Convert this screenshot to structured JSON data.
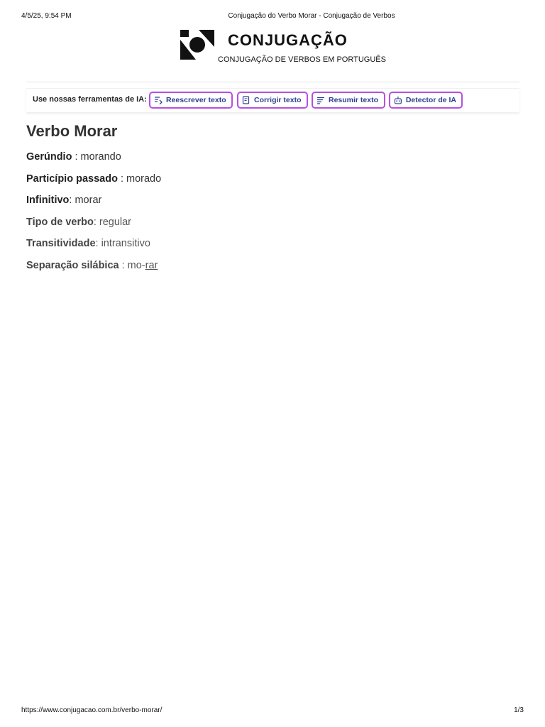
{
  "print_header": {
    "date": "4/5/25, 9:54 PM",
    "title": "Conjugação do Verbo Morar - Conjugação de Verbos"
  },
  "brand": {
    "name": "CONJUGAÇÃO",
    "tagline": "CONJUGAÇÃO DE VERBOS EM PORTUGUÊS",
    "logo_icon": "conjugacao-logo"
  },
  "tools": {
    "label": "Use nossas ferramentas de IA:",
    "accent_border": "#b64fe0",
    "text_color": "#2c3f8f",
    "buttons": [
      {
        "label": "Reescrever texto",
        "icon": "rewrite-icon"
      },
      {
        "label": "Corrigir texto",
        "icon": "correct-icon"
      },
      {
        "label": "Resumir texto",
        "icon": "summarize-icon"
      },
      {
        "label": "Detector de IA",
        "icon": "robot-icon"
      }
    ]
  },
  "verb": {
    "title": "Verbo Morar",
    "gerund_label": "Gerúndio",
    "gerund_value": " : morando",
    "participle_label": "Particípio passado",
    "participle_value": " : morado",
    "infinitive_label": "Infinitivo",
    "infinitive_value": ": morar",
    "type_label": "Tipo de verbo",
    "type_value": ": regular",
    "transitivity_label": "Transitividade",
    "transitivity_value": ": intransitivo",
    "syllables_label": "Separação silábica",
    "syllables_prefix": " : mo-",
    "syllables_stressed": "rar"
  },
  "print_footer": {
    "url": "https://www.conjugacao.com.br/verbo-morar/",
    "page": "1/3"
  }
}
